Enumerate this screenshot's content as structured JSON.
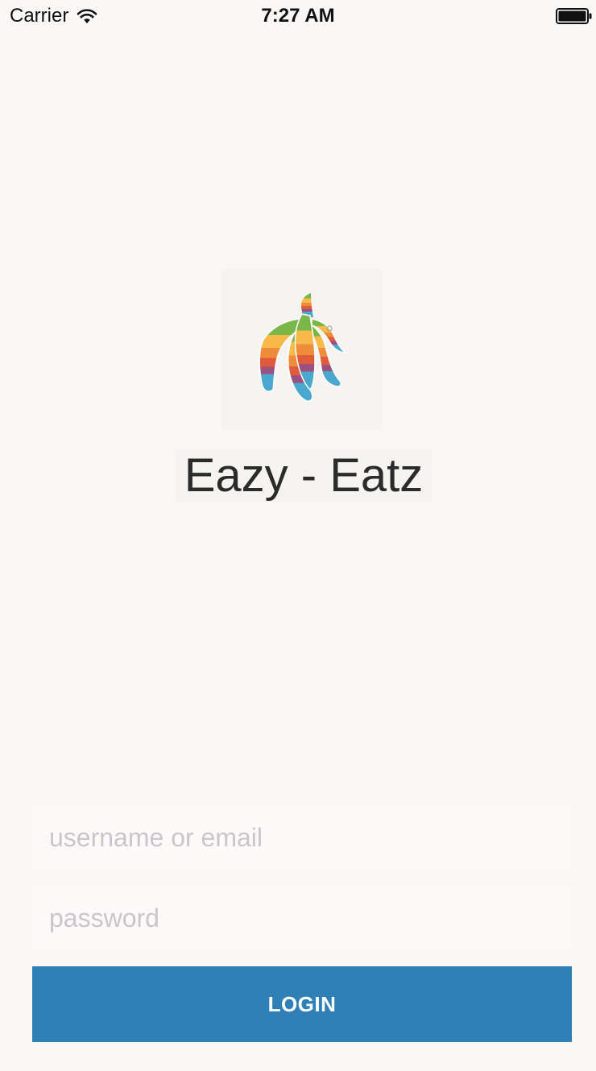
{
  "status_bar": {
    "carrier": "Carrier",
    "time": "7:27 AM",
    "wifi_icon": "wifi-icon",
    "battery_icon": "battery-icon"
  },
  "app": {
    "logo_icon": "banana-logo",
    "title": "Eazy - Eatz"
  },
  "login_form": {
    "username_placeholder": "username or email",
    "username_value": "",
    "password_placeholder": "password",
    "password_value": "",
    "login_label": "LOGIN"
  },
  "colors": {
    "background": "#f9f8f6",
    "button": "#2f80b7",
    "button_text": "#ffffff",
    "placeholder": "#c8c6cc",
    "title_text": "#2b2b2b"
  }
}
